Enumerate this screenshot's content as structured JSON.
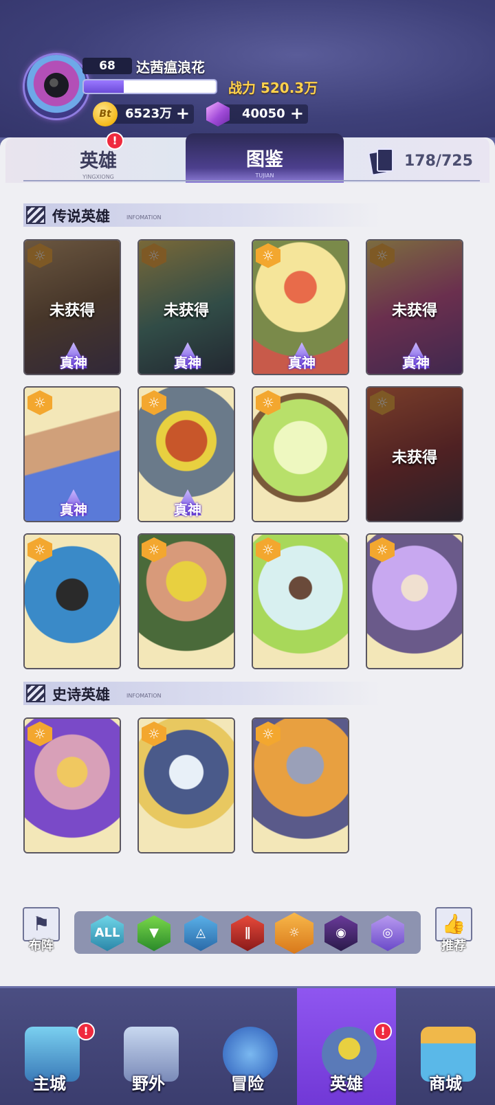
{
  "player": {
    "level": "68",
    "name": "达茜瘟浪花",
    "exp_fraction": 0.3,
    "power_label": "战力 520.3万",
    "coins": "6523万",
    "gems": "40050",
    "plus": "+"
  },
  "tabs": {
    "hero": {
      "label": "英雄",
      "sub": "YINGXIONG",
      "badge": "!"
    },
    "dex": {
      "label": "图鉴",
      "sub": "TUJIAN"
    },
    "count": "178/725"
  },
  "sections": {
    "legend": {
      "title": "传说英雄",
      "sub": "INFOMATION"
    },
    "epic": {
      "title": "史诗英雄",
      "sub": "INFOMATION"
    }
  },
  "labels": {
    "locked": "未获得",
    "god": "真神",
    "coin_glyph": "Bt"
  },
  "filters": {
    "formation": "布阵",
    "recommend": "推荐",
    "all": "ALL"
  },
  "nav": {
    "city": "主城",
    "wild": "野外",
    "adventure": "冒险",
    "hero": "英雄",
    "shop": "商城",
    "badge": "!"
  },
  "colors": {
    "accent": "#7a4fe0",
    "badge": "#ef2a3e",
    "gold": "#ffd24d",
    "hex_orange": "#f3a72f"
  }
}
